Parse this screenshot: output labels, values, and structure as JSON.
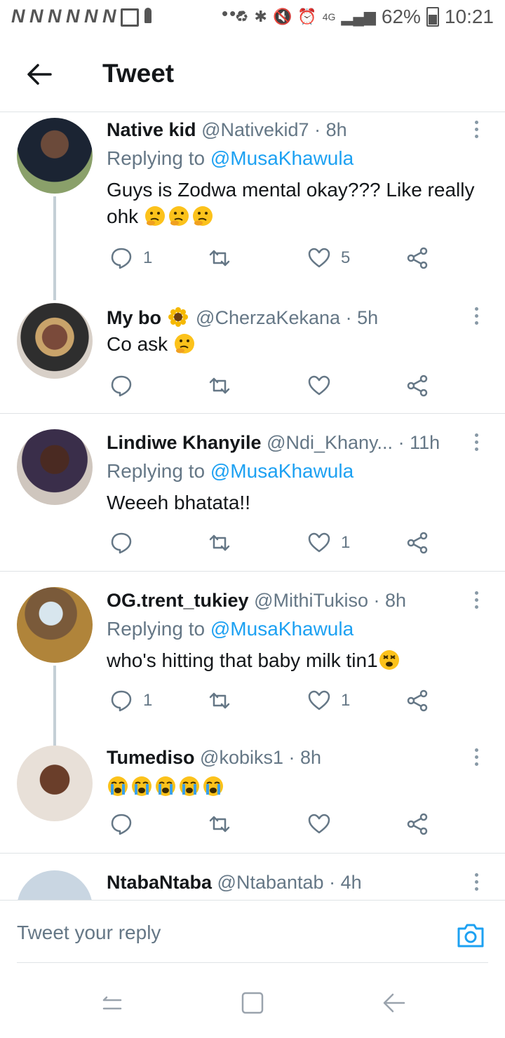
{
  "status_bar": {
    "notification_icons": [
      "N",
      "N",
      "N",
      "N",
      "N",
      "N"
    ],
    "network": "4G",
    "battery": "62%",
    "time": "10:21",
    "more_indicator": "•••"
  },
  "header": {
    "title": "Tweet"
  },
  "tweets": [
    {
      "name": "Native kid",
      "handle": "@Nativekid7",
      "time": "· 8h",
      "reply_prefix": "Replying to ",
      "reply_to": "@MusaKhawula",
      "text": "Guys is Zodwa mental okay??? Like really ohk",
      "emoji": [
        "thinking",
        "thinking",
        "thinking"
      ],
      "replies": "1",
      "retweets": "",
      "likes": "5"
    },
    {
      "name": "My bo",
      "name_emoji": "sunflower",
      "handle": "@CherzaKekana",
      "time": "· 5h",
      "text": "Co ask",
      "emoji": [
        "thinking"
      ],
      "replies": "",
      "retweets": "",
      "likes": ""
    },
    {
      "name": "Lindiwe Khanyile",
      "handle": "@Ndi_Khany...",
      "time": "· 11h",
      "reply_prefix": "Replying to ",
      "reply_to": "@MusaKhawula",
      "text": "Weeeh bhatata!!",
      "replies": "",
      "retweets": "",
      "likes": "1"
    },
    {
      "name": "OG.trent_tukiey",
      "handle": "@MithiTukiso",
      "time": "· 8h",
      "reply_prefix": "Replying to ",
      "reply_to": "@MusaKhawula",
      "text": "who's hitting that baby milk tin1",
      "emoji": [
        "dizzy-face"
      ],
      "replies": "1",
      "retweets": "",
      "likes": "1"
    },
    {
      "name": "Tumediso",
      "handle": "@kobiks1",
      "time": "· 8h",
      "text": "",
      "emoji": [
        "crying",
        "crying",
        "crying",
        "crying",
        "crying"
      ],
      "replies": "",
      "retweets": "",
      "likes": ""
    },
    {
      "name": "NtabaNtaba",
      "handle": "@Ntabantab",
      "time": "· 4h",
      "text": ""
    }
  ],
  "reply_bar": {
    "placeholder": "Tweet your reply"
  },
  "colors": {
    "accent": "#1da1f2",
    "secondary_text": "#657786",
    "divider": "#dfe3e6"
  }
}
